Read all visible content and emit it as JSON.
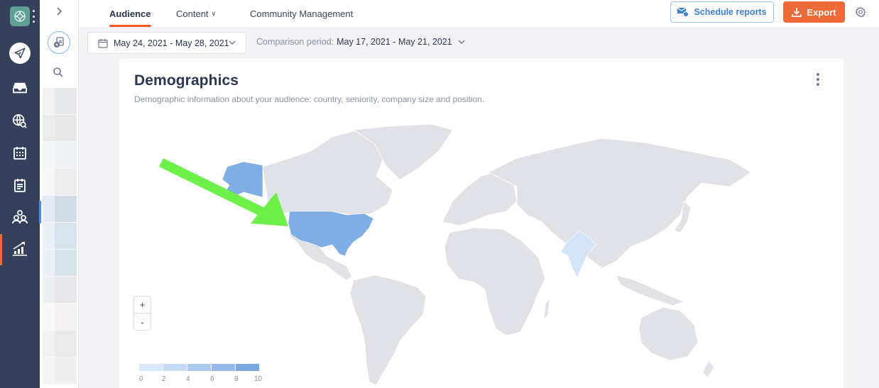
{
  "nav_rail": {
    "items": [
      {
        "id": "publish",
        "icon": "paper-plane-icon"
      },
      {
        "id": "inbox",
        "icon": "inbox-tray-icon"
      },
      {
        "id": "listening",
        "icon": "globe-search-icon"
      },
      {
        "id": "calendar",
        "icon": "calendar-grid-icon"
      },
      {
        "id": "planner",
        "icon": "notepad-icon"
      },
      {
        "id": "audience",
        "icon": "people-group-icon"
      },
      {
        "id": "analytics",
        "icon": "bar-chart-trend-icon",
        "active": true
      }
    ],
    "active_color": "#f0683a"
  },
  "secondary_column": {
    "expand_icon": "chevron-right-icon",
    "add_report_icon": "add-report-icon",
    "search_icon": "search-icon"
  },
  "tabs": [
    {
      "label": "Audience",
      "active": true
    },
    {
      "label": "Content",
      "has_dropdown": true
    },
    {
      "label": "Community Management"
    }
  ],
  "toolbar": {
    "schedule_label": "Schedule reports",
    "export_label": "Export"
  },
  "filters": {
    "date_range": "May 24, 2021 - May 28, 2021",
    "comparison_label": "Comparison period:",
    "comparison_value": "May 17, 2021 - May 21, 2021"
  },
  "card": {
    "title": "Demographics",
    "subtitle": "Demographic information about your audience: country, seniority, company size and position."
  },
  "map": {
    "zoom_in": "+",
    "zoom_out": "-",
    "highlighted_countries": [
      {
        "name": "United States",
        "level": "high",
        "color": "#7eaee3"
      },
      {
        "name": "India",
        "level": "low",
        "color": "#d5e5f7"
      }
    ],
    "base_land_color": "#e1e2e7",
    "annotation": "green arrow pointing to United States",
    "annotation_color": "#6ef04a"
  },
  "legend": {
    "ticks": [
      "0",
      "2",
      "4",
      "6",
      "8",
      "10"
    ],
    "colors": [
      "#d9e7f8",
      "#c4d9f3",
      "#adcaef",
      "#95baea",
      "#7aa8e3"
    ]
  }
}
